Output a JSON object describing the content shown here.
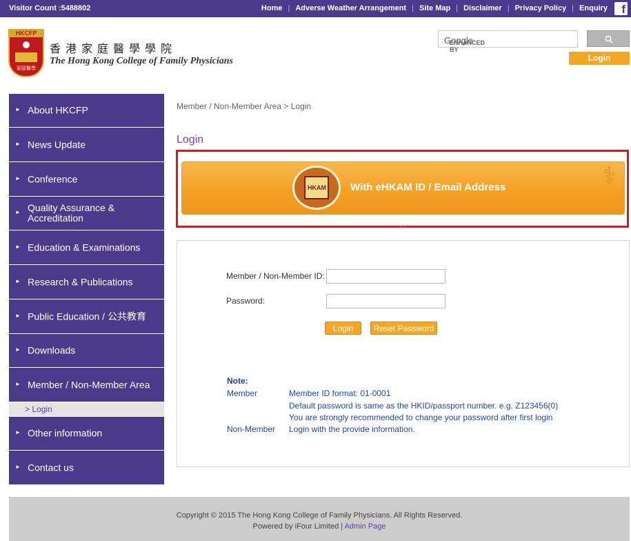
{
  "topbar": {
    "visitor_count": "Visitor Count :5488802",
    "links": [
      "Home",
      "Adverse Weather Arrangement",
      "Site Map",
      "Disclaimer",
      "Privacy Policy",
      "Enquiry"
    ],
    "facebook_icon": "facebook-icon"
  },
  "header": {
    "logo_abbr": "HKCFP",
    "logo_motto": "家庭醫學",
    "title_cn": "香港家庭醫學學院",
    "title_en": "The Hong Kong College of Family Physicians",
    "search_label": "ENHANCED BY",
    "search_brand": "Google",
    "login_label": "Login"
  },
  "sidebar": {
    "items": [
      {
        "label": "About HKCFP"
      },
      {
        "label": "News Update"
      },
      {
        "label": "Conference"
      },
      {
        "label": "Quality Assurance & Accreditation"
      },
      {
        "label": "Education & Examinations"
      },
      {
        "label": "Research & Publications"
      },
      {
        "label": "Public Education / 公共教育"
      },
      {
        "label": "Downloads"
      },
      {
        "label": "Member / Non-Member Area"
      },
      {
        "label": "Other information"
      },
      {
        "label": "Contact us"
      }
    ],
    "sub_item": "> Login"
  },
  "main": {
    "breadcrumb": "Member / Non-Member Area > Login",
    "page_title": "Login",
    "banner_text": "With eHKAM ID / Email Address",
    "banner_seal_text": "HKAM"
  },
  "form": {
    "id_label": "Member / Non-Member ID:",
    "id_value": "",
    "password_label": "Password:",
    "password_value": "",
    "login_button": "Login",
    "reset_button": "Reset Password"
  },
  "note": {
    "heading": "Note:",
    "member_label": "Member",
    "member_lines": [
      "Member ID format: 01-0001",
      "Default password is same as the HKID/passport number. e.g. Z123456(0)",
      "You are strongly recommended to change your password after first login"
    ],
    "nonmember_label": "Non-Member",
    "nonmember_line": "Login with the provide information."
  },
  "footer": {
    "copyright": "Copyright © 2015 The Hong Kong College of Family Physicians. All Rights Reserved.",
    "powered": "Powered by iFour Limited |",
    "admin_link": "Admin Page"
  },
  "colors": {
    "nav_purple": "#4b3a8c",
    "accent_orange": "#f5a623",
    "highlight_red": "#e1141d"
  }
}
